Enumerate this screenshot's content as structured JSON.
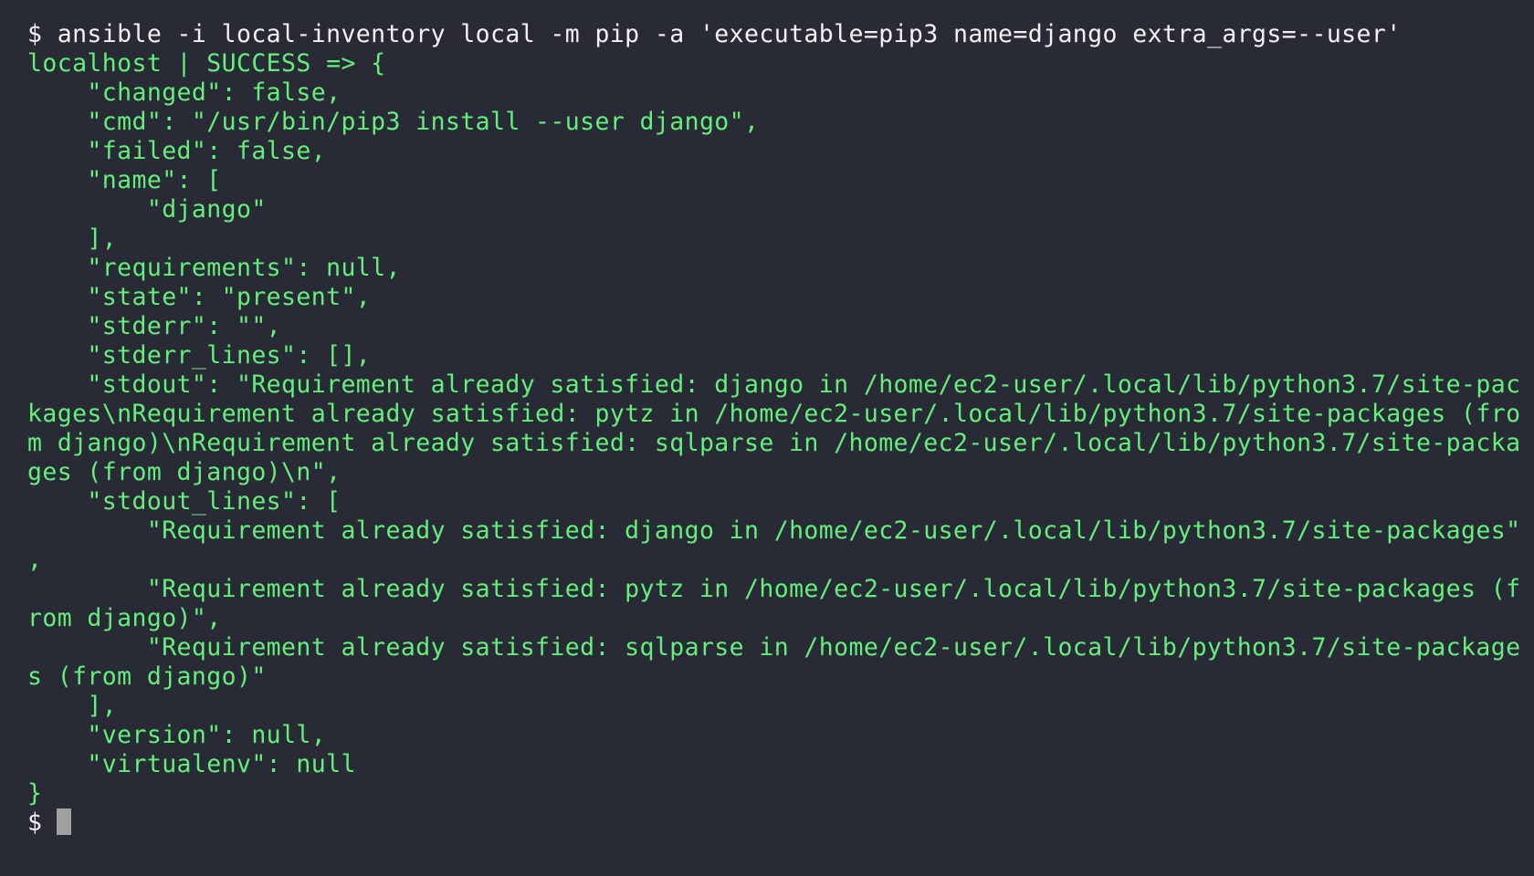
{
  "terminal": {
    "prompt": "$",
    "command": "$ ansible -i local-inventory local -m pip -a 'executable=pip3 name=django extra_args=--user'",
    "output_lines": [
      "localhost | SUCCESS => {",
      "    \"changed\": false,",
      "    \"cmd\": \"/usr/bin/pip3 install --user django\",",
      "    \"failed\": false,",
      "    \"name\": [",
      "        \"django\"",
      "    ],",
      "    \"requirements\": null,",
      "    \"state\": \"present\",",
      "    \"stderr\": \"\",",
      "    \"stderr_lines\": [],",
      "    \"stdout\": \"Requirement already satisfied: django in /home/ec2-user/.local/lib/python3.7/site-pac",
      "kages\\nRequirement already satisfied: pytz in /home/ec2-user/.local/lib/python3.7/site-packages (fro",
      "m django)\\nRequirement already satisfied: sqlparse in /home/ec2-user/.local/lib/python3.7/site-packa",
      "ges (from django)\\n\",",
      "    \"stdout_lines\": [",
      "        \"Requirement already satisfied: django in /home/ec2-user/.local/lib/python3.7/site-packages\"",
      ",",
      "        \"Requirement already satisfied: pytz in /home/ec2-user/.local/lib/python3.7/site-packages (f",
      "rom django)\",",
      "        \"Requirement already satisfied: sqlparse in /home/ec2-user/.local/lib/python3.7/site-package",
      "s (from django)\"",
      "    ],",
      "    \"version\": null,",
      "    \"virtualenv\": null",
      "}"
    ],
    "colors": {
      "background": "#282a36",
      "command_text": "#f2f2f2",
      "output_text": "#63f07a",
      "cursor": "#a0a0a0"
    }
  }
}
